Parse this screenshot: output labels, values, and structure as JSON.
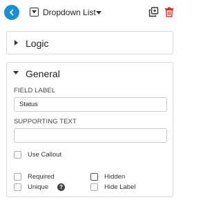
{
  "header": {
    "field_type": "Dropdown List",
    "back_icon": "chevron-left-icon",
    "copy_icon": "copy-icon",
    "delete_icon": "trash-icon",
    "accent_color": "#1a8fd6",
    "delete_color": "#d93025"
  },
  "sections": {
    "logic": {
      "title": "Logic",
      "expanded": false
    },
    "general": {
      "title": "General",
      "expanded": true
    }
  },
  "general": {
    "field_label_caption": "FIELD LABEL",
    "field_label_value": "Status",
    "supporting_text_caption": "SUPPORTING TEXT",
    "supporting_text_value": "",
    "use_callout_label": "Use Callout",
    "required_label": "Required",
    "hidden_label": "Hidden",
    "unique_label": "Unique",
    "unique_help_glyph": "?",
    "hide_label_label": "Hide Label"
  }
}
